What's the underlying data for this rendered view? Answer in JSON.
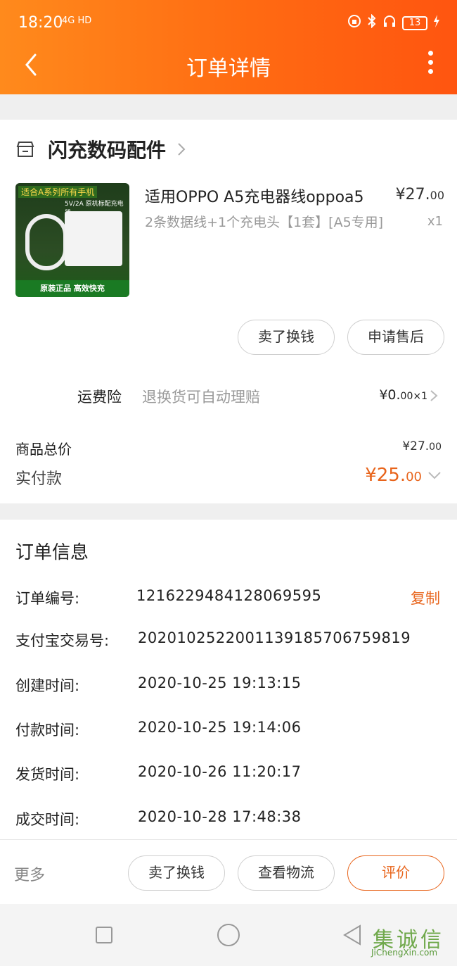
{
  "status_bar": {
    "time": "18:20",
    "network": "4G HD",
    "battery": "13"
  },
  "header": {
    "title": "订单详情"
  },
  "shop": {
    "name": "闪充数码配件"
  },
  "product": {
    "thumb_banner": "适合A系列所有手机",
    "thumb_spec": "5V/2A 原机标配充电器",
    "thumb_footer": "原装正品  高效快充",
    "title": "适用OPPO A5充电器线oppoa5",
    "desc": "2条数据线+1个充电头【1套】[A5专用]",
    "price_int": "¥27.",
    "price_dec": "00",
    "qty": "x1"
  },
  "item_actions": {
    "sell": "卖了换钱",
    "after_sale": "申请售后"
  },
  "insurance": {
    "label": "运费险",
    "text": "退换货可自动理赔",
    "price_int": "¥0.",
    "price_dec": "00",
    "qty": "×1"
  },
  "totals": {
    "goods_label": "商品总价",
    "goods_int": "¥27.",
    "goods_dec": "00",
    "paid_label": "实付款",
    "paid_int": "¥25.",
    "paid_dec": "00"
  },
  "order_info": {
    "title": "订单信息",
    "rows": [
      {
        "label": "订单编号:",
        "value": "1216229484128069595"
      },
      {
        "label": "支付宝交易号:",
        "value": "2020102522001139185706759819"
      },
      {
        "label": "创建时间:",
        "value": "2020-10-25 19:13:15"
      },
      {
        "label": "付款时间:",
        "value": "2020-10-25 19:14:06"
      },
      {
        "label": "发货时间:",
        "value": "2020-10-26 11:20:17"
      },
      {
        "label": "成交时间:",
        "value": "2020-10-28 17:48:38"
      }
    ],
    "copy": "复制"
  },
  "bottom": {
    "more": "更多",
    "sell": "卖了换钱",
    "logistics": "查看物流",
    "review": "评价"
  },
  "watermark": {
    "main": "集诚信",
    "sub": "JiChengXin.com"
  }
}
